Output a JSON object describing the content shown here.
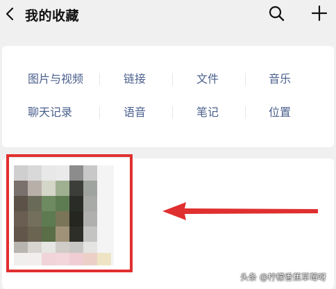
{
  "header": {
    "title": "我的收藏"
  },
  "categories": {
    "row1": [
      "图片与视频",
      "链接",
      "文件",
      "音乐"
    ],
    "row2": [
      "聊天记录",
      "语音",
      "笔记",
      "位置"
    ]
  },
  "colors": {
    "category_text": "#4a5f8c",
    "highlight": "#e02f2f",
    "background": "#f0f0f0"
  },
  "icons": [
    "back-icon",
    "search-icon",
    "plus-icon",
    "arrow-icon"
  ],
  "watermark": {
    "text": "头条 @柠檬香蕉草莓呀"
  }
}
